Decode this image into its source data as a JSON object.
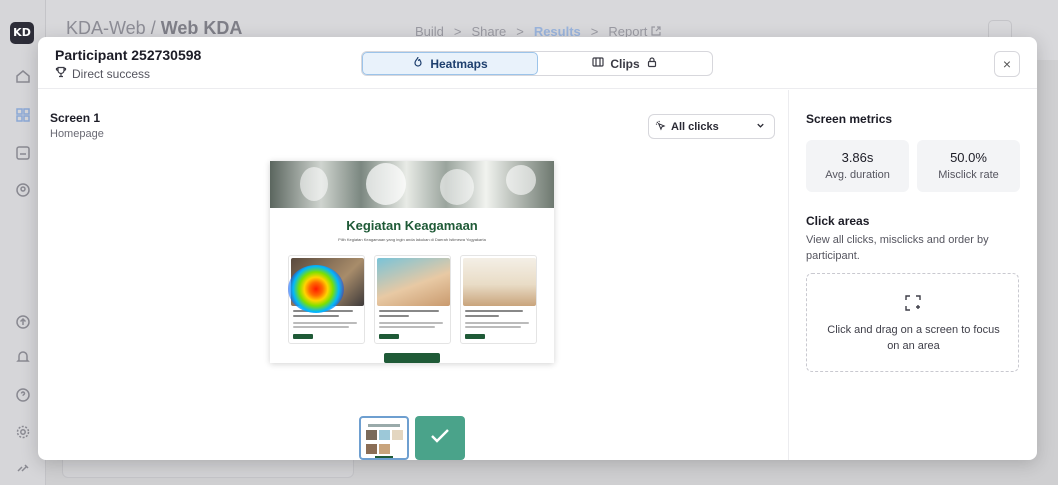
{
  "app": {
    "logo": "KD",
    "breadcrumb_project": "KDA-Web",
    "breadcrumb_separator": "/",
    "breadcrumb_page": "Web KDA",
    "steps": [
      "Build",
      "Share",
      "Results",
      "Report"
    ],
    "step_separator": ">",
    "active_step": "Results",
    "report_icon": "external-link-icon",
    "sidebar_icons": [
      "home-icon",
      "grid-icon",
      "inbox-icon",
      "user-circle-icon",
      "upload-icon",
      "bell-icon",
      "help-icon",
      "settings-icon",
      "link-icon"
    ]
  },
  "modal": {
    "participant_title": "Participant 252730598",
    "participant_status": "Direct success",
    "status_icon": "trophy-icon",
    "tabs": [
      {
        "label": "Heatmaps",
        "icon": "flame-icon",
        "active": true
      },
      {
        "label": "Clips",
        "icon": "film-icon",
        "lock_icon": "lock-icon",
        "active": false
      }
    ],
    "close_icon": "close-icon",
    "close_label": "×"
  },
  "screen": {
    "title": "Screen 1",
    "subtitle": "Homepage",
    "filter_label": "All clicks",
    "filter_icon": "cursor-click-icon",
    "filter_chevron": "chevron-down-icon"
  },
  "preview": {
    "title": "Kegiatan Keagamaan",
    "subtitle": "Pilih Kegiatan Keagamaan yang ingin anda lakukan di Daerah Istimewa Yogyakarta",
    "heatmap_overlay": true
  },
  "metrics": {
    "title": "Screen metrics",
    "items": [
      {
        "value": "3.86s",
        "label": "Avg. duration"
      },
      {
        "value": "50.0%",
        "label": "Misclick rate"
      }
    ]
  },
  "click_areas": {
    "title": "Click areas",
    "description": "View all clicks, misclicks and order by participant.",
    "drop_text": "Click and drag on a screen to focus on an area",
    "drop_icon": "select-area-icon"
  },
  "thumbnails": [
    {
      "name": "screen-1",
      "selected": true
    },
    {
      "name": "success-screen",
      "icon": "check-icon",
      "selected": false
    }
  ],
  "colors": {
    "accent_blue": "#9cc4ea",
    "heading_green": "#1f5a37",
    "success_teal": "#4aa38a"
  }
}
